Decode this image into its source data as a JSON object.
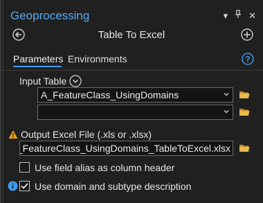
{
  "pane": {
    "title": "Geoprocessing",
    "menu_glyph": "▾",
    "pin_glyph": "ᛘ",
    "close_glyph": "✕"
  },
  "tool": {
    "title": "Table To Excel"
  },
  "tabs": [
    {
      "label": "Parameters",
      "active": true
    },
    {
      "label": "Environments",
      "active": false
    }
  ],
  "params": {
    "input_table_label": "Input Table",
    "input_table_values": [
      "A_FeatureClass_UsingDomains",
      ""
    ],
    "output_label": "Output Excel File (.xls or .xlsx)",
    "output_value": "ACE\\A_FeatureClass_UsingDomains_TableToExcel.xlsx",
    "field_alias_label": "Use field alias as column header",
    "field_alias_checked": false,
    "domain_label": "Use domain and subtype description",
    "domain_checked": true
  },
  "colors": {
    "accent": "#3d9bf0",
    "title_blue": "#59a8f0",
    "folder_yellow": "#e9b949",
    "warning_orange": "#e8a21a"
  },
  "icons": {
    "back": "back-arrow-icon",
    "add": "add-icon",
    "help": "help-icon",
    "expand": "chevron-down-icon",
    "folder": "folder-icon",
    "warning": "warning-icon",
    "info": "info-icon"
  }
}
